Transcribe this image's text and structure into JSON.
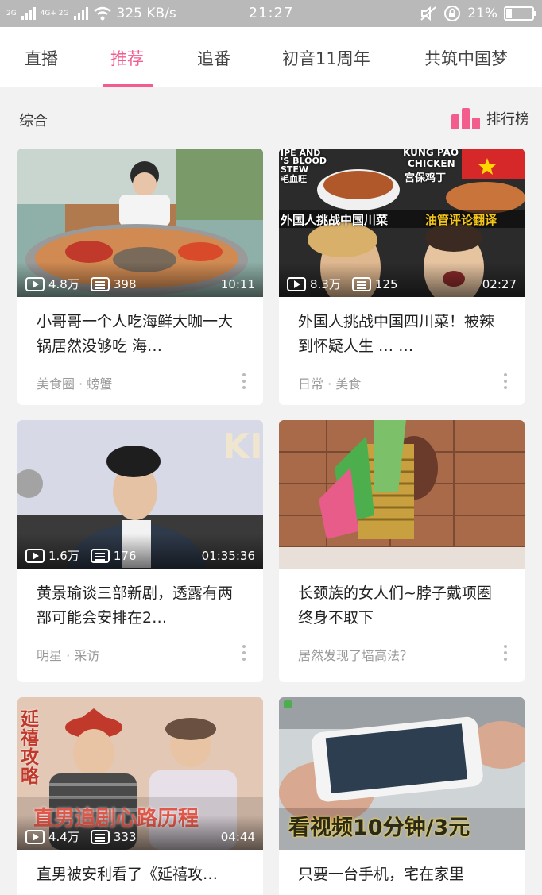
{
  "status_bar": {
    "network_1": "2G",
    "network_2": "4G+ 2G",
    "speed": "325 KB/s",
    "time": "21:27",
    "battery_percent": "21%",
    "battery_level": 0.21
  },
  "tabs": [
    {
      "label": "直播",
      "active": false
    },
    {
      "label": "推荐",
      "active": true
    },
    {
      "label": "追番",
      "active": false
    },
    {
      "label": "初音11周年",
      "active": false
    },
    {
      "label": "共筑中国梦",
      "active": false
    }
  ],
  "section": {
    "title": "综合",
    "rank_label": "排行榜"
  },
  "accent_color": "#f25d8e",
  "cards": [
    {
      "views": "4.8万",
      "danmaku": "398",
      "duration": "10:11",
      "title": "小哥哥一个人吃海鲜大咖一大锅居然没够吃 海…",
      "tag": "美食圈 · 螃蟹"
    },
    {
      "views": "8.3万",
      "danmaku": "125",
      "duration": "02:27",
      "title": "外国人挑战中国四川菜！被辣到怀疑人生 … …",
      "tag": "日常 · 美食",
      "thumb_text": {
        "top_left_1": "IPE AND",
        "top_left_2": "'S BLOOD",
        "top_left_3": "STEW",
        "top_left_4": "毛血旺",
        "top_right_1": "KUNG PAO",
        "top_right_2": "CHICKEN",
        "top_right_3": "宫保鸡丁",
        "banner_white": "外国人挑战中国川菜",
        "banner_yellow": "油管评论翻译"
      }
    },
    {
      "views": "1.6万",
      "danmaku": "176",
      "duration": "01:35:36",
      "title": "黄景瑜谈三部新剧，透露有两部可能会安排在2…",
      "tag": "明星 · 采访",
      "thumb_text": {
        "logo": "KI"
      }
    },
    {
      "views": "",
      "danmaku": "",
      "duration": "",
      "title": "长颈族的女人们~脖子戴项圈终身不取下",
      "tag": "居然发现了墙高法？"
    },
    {
      "views": "4.4万",
      "danmaku": "333",
      "duration": "04:44",
      "title": "直男被安利看了《延禧攻…",
      "tag": "",
      "thumb_text": {
        "side": "延禧攻略",
        "caption": "直男追剧心路历程"
      }
    },
    {
      "views": "",
      "danmaku": "",
      "duration": "",
      "title": "只要一台手机，宅在家里",
      "tag": "",
      "thumb_text": {
        "caption": "看视频10分钟/3元"
      }
    }
  ]
}
